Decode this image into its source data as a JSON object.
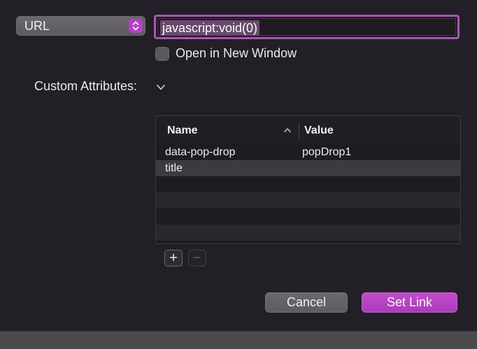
{
  "link_type": {
    "selected": "URL",
    "icon": "chevron-updown-icon",
    "accent": "#b83ec8"
  },
  "url_field": {
    "value": "javascript:void(0)"
  },
  "open_new_window": {
    "label": "Open in New Window",
    "checked": false
  },
  "custom_attributes": {
    "label": "Custom Attributes:",
    "columns": [
      "Name",
      "Value"
    ],
    "rows": [
      {
        "name": "data-pop-drop",
        "value": "popDrop1"
      },
      {
        "name": "title",
        "value": ""
      }
    ],
    "add_label": "+",
    "remove_label": "−"
  },
  "buttons": {
    "cancel": "Cancel",
    "set_link": "Set Link"
  },
  "colors": {
    "background": "#231f26",
    "accent": "#bf4dcb",
    "field_focus": "#a557b3"
  }
}
